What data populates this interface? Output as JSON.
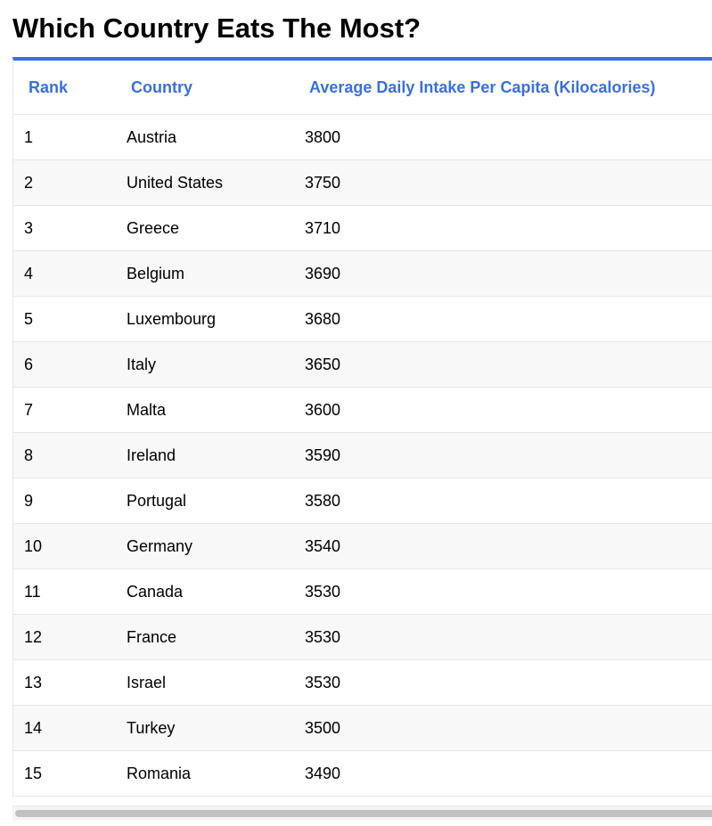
{
  "page": {
    "title": "Which Country Eats The Most?"
  },
  "table": {
    "headers": {
      "rank": "Rank",
      "country": "Country",
      "intake": "Average Daily Intake Per Capita (Kilocalories)"
    },
    "rows": [
      {
        "rank": "1",
        "country": "Austria",
        "intake": "3800"
      },
      {
        "rank": "2",
        "country": "United States",
        "intake": "3750"
      },
      {
        "rank": "3",
        "country": "Greece",
        "intake": "3710"
      },
      {
        "rank": "4",
        "country": "Belgium",
        "intake": "3690"
      },
      {
        "rank": "5",
        "country": "Luxembourg",
        "intake": "3680"
      },
      {
        "rank": "6",
        "country": "Italy",
        "intake": "3650"
      },
      {
        "rank": "7",
        "country": "Malta",
        "intake": "3600"
      },
      {
        "rank": "8",
        "country": "Ireland",
        "intake": "3590"
      },
      {
        "rank": "9",
        "country": "Portugal",
        "intake": "3580"
      },
      {
        "rank": "10",
        "country": "Germany",
        "intake": "3540"
      },
      {
        "rank": "11",
        "country": "Canada",
        "intake": "3530"
      },
      {
        "rank": "12",
        "country": "France",
        "intake": "3530"
      },
      {
        "rank": "13",
        "country": "Israel",
        "intake": "3530"
      },
      {
        "rank": "14",
        "country": "Turkey",
        "intake": "3500"
      },
      {
        "rank": "15",
        "country": "Romania",
        "intake": "3490"
      }
    ]
  },
  "colors": {
    "accent": "#3b6fe0",
    "row_stripe": "#f8f8f8",
    "border": "#e6e6e6"
  }
}
